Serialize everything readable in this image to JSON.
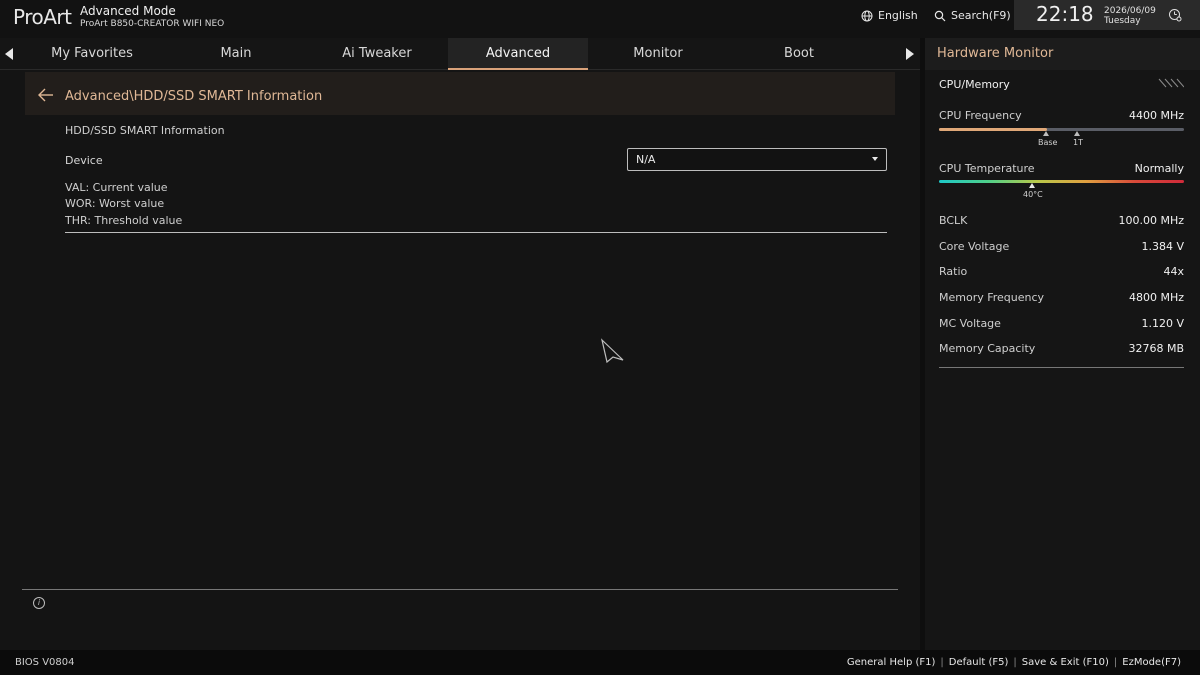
{
  "header": {
    "logo": "ProArt",
    "mode_title": "Advanced Mode",
    "board_name": "ProArt B850-CREATOR WIFI NEO",
    "language_label": "English",
    "search_label": "Search(F9)",
    "time": "22:18",
    "date": "2026/06/09",
    "weekday": "Tuesday"
  },
  "tabs": [
    {
      "label": "My Favorites"
    },
    {
      "label": "Main"
    },
    {
      "label": "Ai Tweaker"
    },
    {
      "label": "Advanced"
    },
    {
      "label": "Monitor"
    },
    {
      "label": "Boot"
    }
  ],
  "active_tab": "Advanced",
  "main": {
    "breadcrumb": "Advanced\\HDD/SSD SMART Information",
    "section_title": "HDD/SSD SMART Information",
    "device_label": "Device",
    "device_value": "N/A",
    "legend": [
      {
        "text": "VAL:  Current value"
      },
      {
        "text": "WOR: Worst value"
      },
      {
        "text": "THR:  Threshold value"
      }
    ]
  },
  "hardware_monitor": {
    "title": "Hardware Monitor",
    "section": "CPU/Memory",
    "cpu_frequency_label": "CPU Frequency",
    "cpu_frequency_value": "4400 MHz",
    "cpu_frequency_fraction": 0.44,
    "base_label": "Base",
    "one_t_label": "1T",
    "cpu_temperature_label": "CPU Temperature",
    "cpu_temperature_value": "Normally",
    "temp_marker_label": "40°C",
    "rows": [
      {
        "label": "BCLK",
        "value": "100.00 MHz"
      },
      {
        "label": "Core Voltage",
        "value": "1.384 V"
      },
      {
        "label": "Ratio",
        "value": "44x"
      },
      {
        "label": "Memory Frequency",
        "value": "4800 MHz"
      },
      {
        "label": "MC Voltage",
        "value": "1.120 V"
      },
      {
        "label": "Memory Capacity",
        "value": "32768 MB"
      }
    ]
  },
  "footer": {
    "bios_version": "BIOS V0804",
    "links": [
      {
        "label": "General Help (F1)"
      },
      {
        "label": "Default (F5)"
      },
      {
        "label": "Save & Exit (F10)"
      },
      {
        "label": "EzMode(F7)"
      }
    ]
  },
  "colors": {
    "accent": "#e0b896",
    "active_tab_underline": "#d9a27a",
    "bar_fill": "#e0a878"
  }
}
